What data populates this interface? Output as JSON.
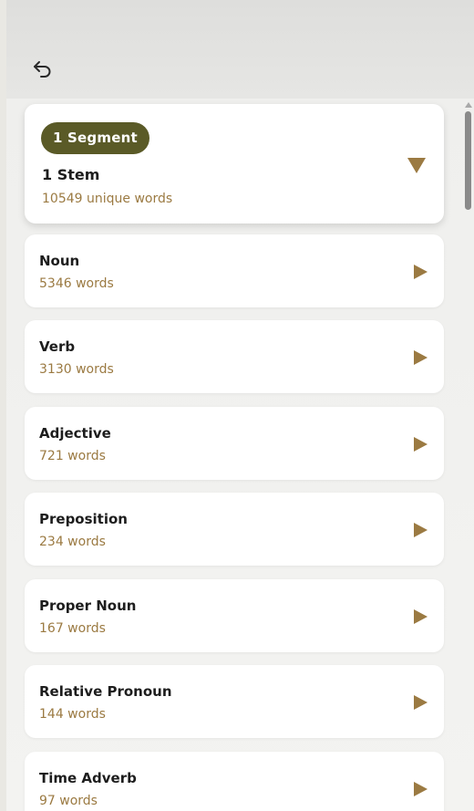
{
  "header": {
    "back_icon": "undo-arrow-icon"
  },
  "expanded_group": {
    "segment_label": "1 Segment",
    "title": "1 Stem",
    "count": "10549 unique words"
  },
  "items": [
    {
      "title": "Noun",
      "count": "5346 words"
    },
    {
      "title": "Verb",
      "count": "3130 words"
    },
    {
      "title": "Adjective",
      "count": "721 words"
    },
    {
      "title": "Preposition",
      "count": "234 words"
    },
    {
      "title": "Proper Noun",
      "count": "167 words"
    },
    {
      "title": "Relative Pronoun",
      "count": "144 words"
    },
    {
      "title": "Time Adverb",
      "count": "97 words"
    }
  ],
  "colors": {
    "badge": "#5a5a27",
    "accent": "#9b7a42",
    "text": "#1d1d1d"
  }
}
